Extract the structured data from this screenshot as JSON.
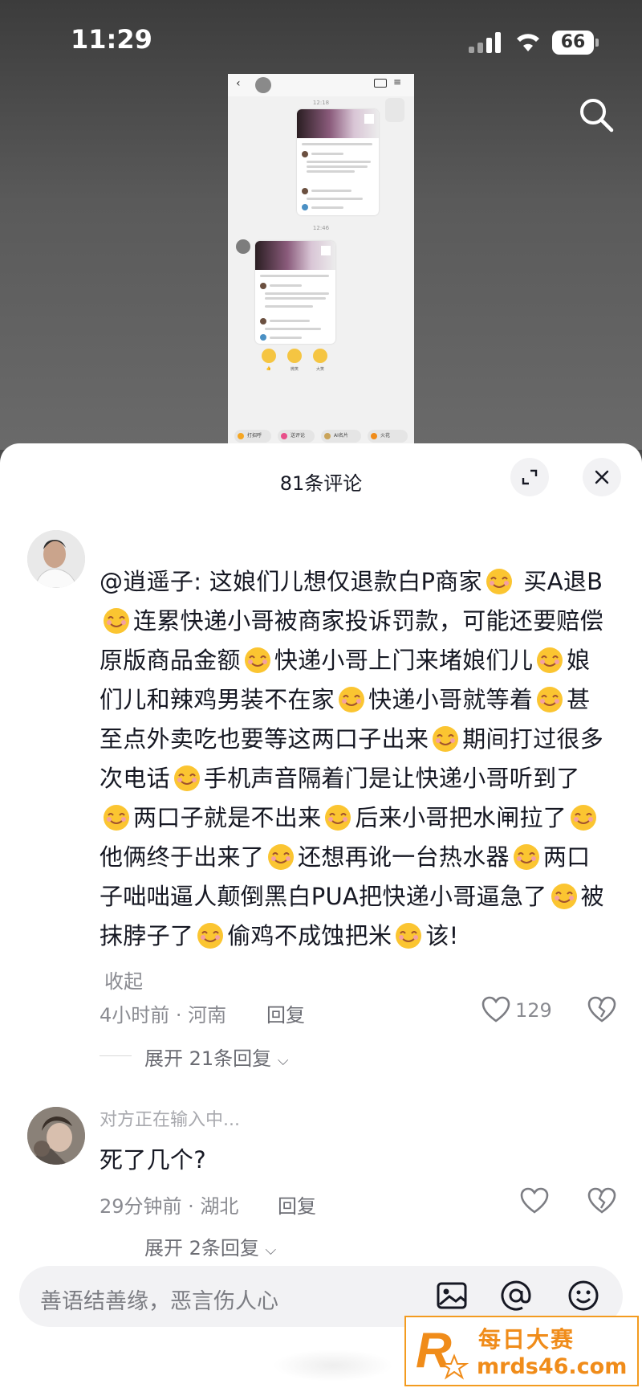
{
  "status_bar": {
    "time": "11:29",
    "battery": "66"
  },
  "embedded_screenshot": {
    "time1": "12:18",
    "time2": "12:46",
    "emoji_labels": [
      "👍",
      "微笑",
      "大笑"
    ],
    "chips": [
      "打招呼",
      "送评论",
      "AI名片",
      "火花"
    ]
  },
  "comments_panel": {
    "title": "81条评论",
    "comments": [
      {
        "text_segments": [
          "@逍遥子: 这娘们儿想仅退款白P商家",
          "买A退B",
          "连累快递小哥被商家投诉罚款，可能还要赔偿原版商品金额",
          "快递小哥上门来堵娘们儿",
          "娘们儿和辣鸡男装不在家",
          "快递小哥就等着",
          "甚至点外卖吃也要等这两口子出来",
          "期间打过很多次电话",
          "手机声音隔着门是让快递小哥听到了",
          "两口子就是不出来",
          "后来小哥把水闸拉了",
          "他俩终于出来了",
          "还想再讹一台热水器",
          "两口子咄咄逼人颠倒黑白PUA把快递小哥逼急了",
          "被抹脖子了",
          "偷鸡不成蚀把米",
          "该!"
        ],
        "collapse_label": "收起",
        "time_location": "4小时前 · 河南",
        "reply_label": "回复",
        "likes": "129",
        "expand_label": "展开 21条回复"
      },
      {
        "typing": "对方正在输入中...",
        "text": "死了几个?",
        "time_location": "29分钟前 · 湖北",
        "reply_label": "回复",
        "expand_label": "展开 2条回复"
      }
    ]
  },
  "input": {
    "placeholder": "善语结善缘，恶言伤人心"
  },
  "watermark": {
    "line1": "每日大赛",
    "line2": "mrds46.com"
  },
  "colors": {
    "accent": "#f08c1a",
    "text": "#161823",
    "meta": "#8a8b91"
  }
}
